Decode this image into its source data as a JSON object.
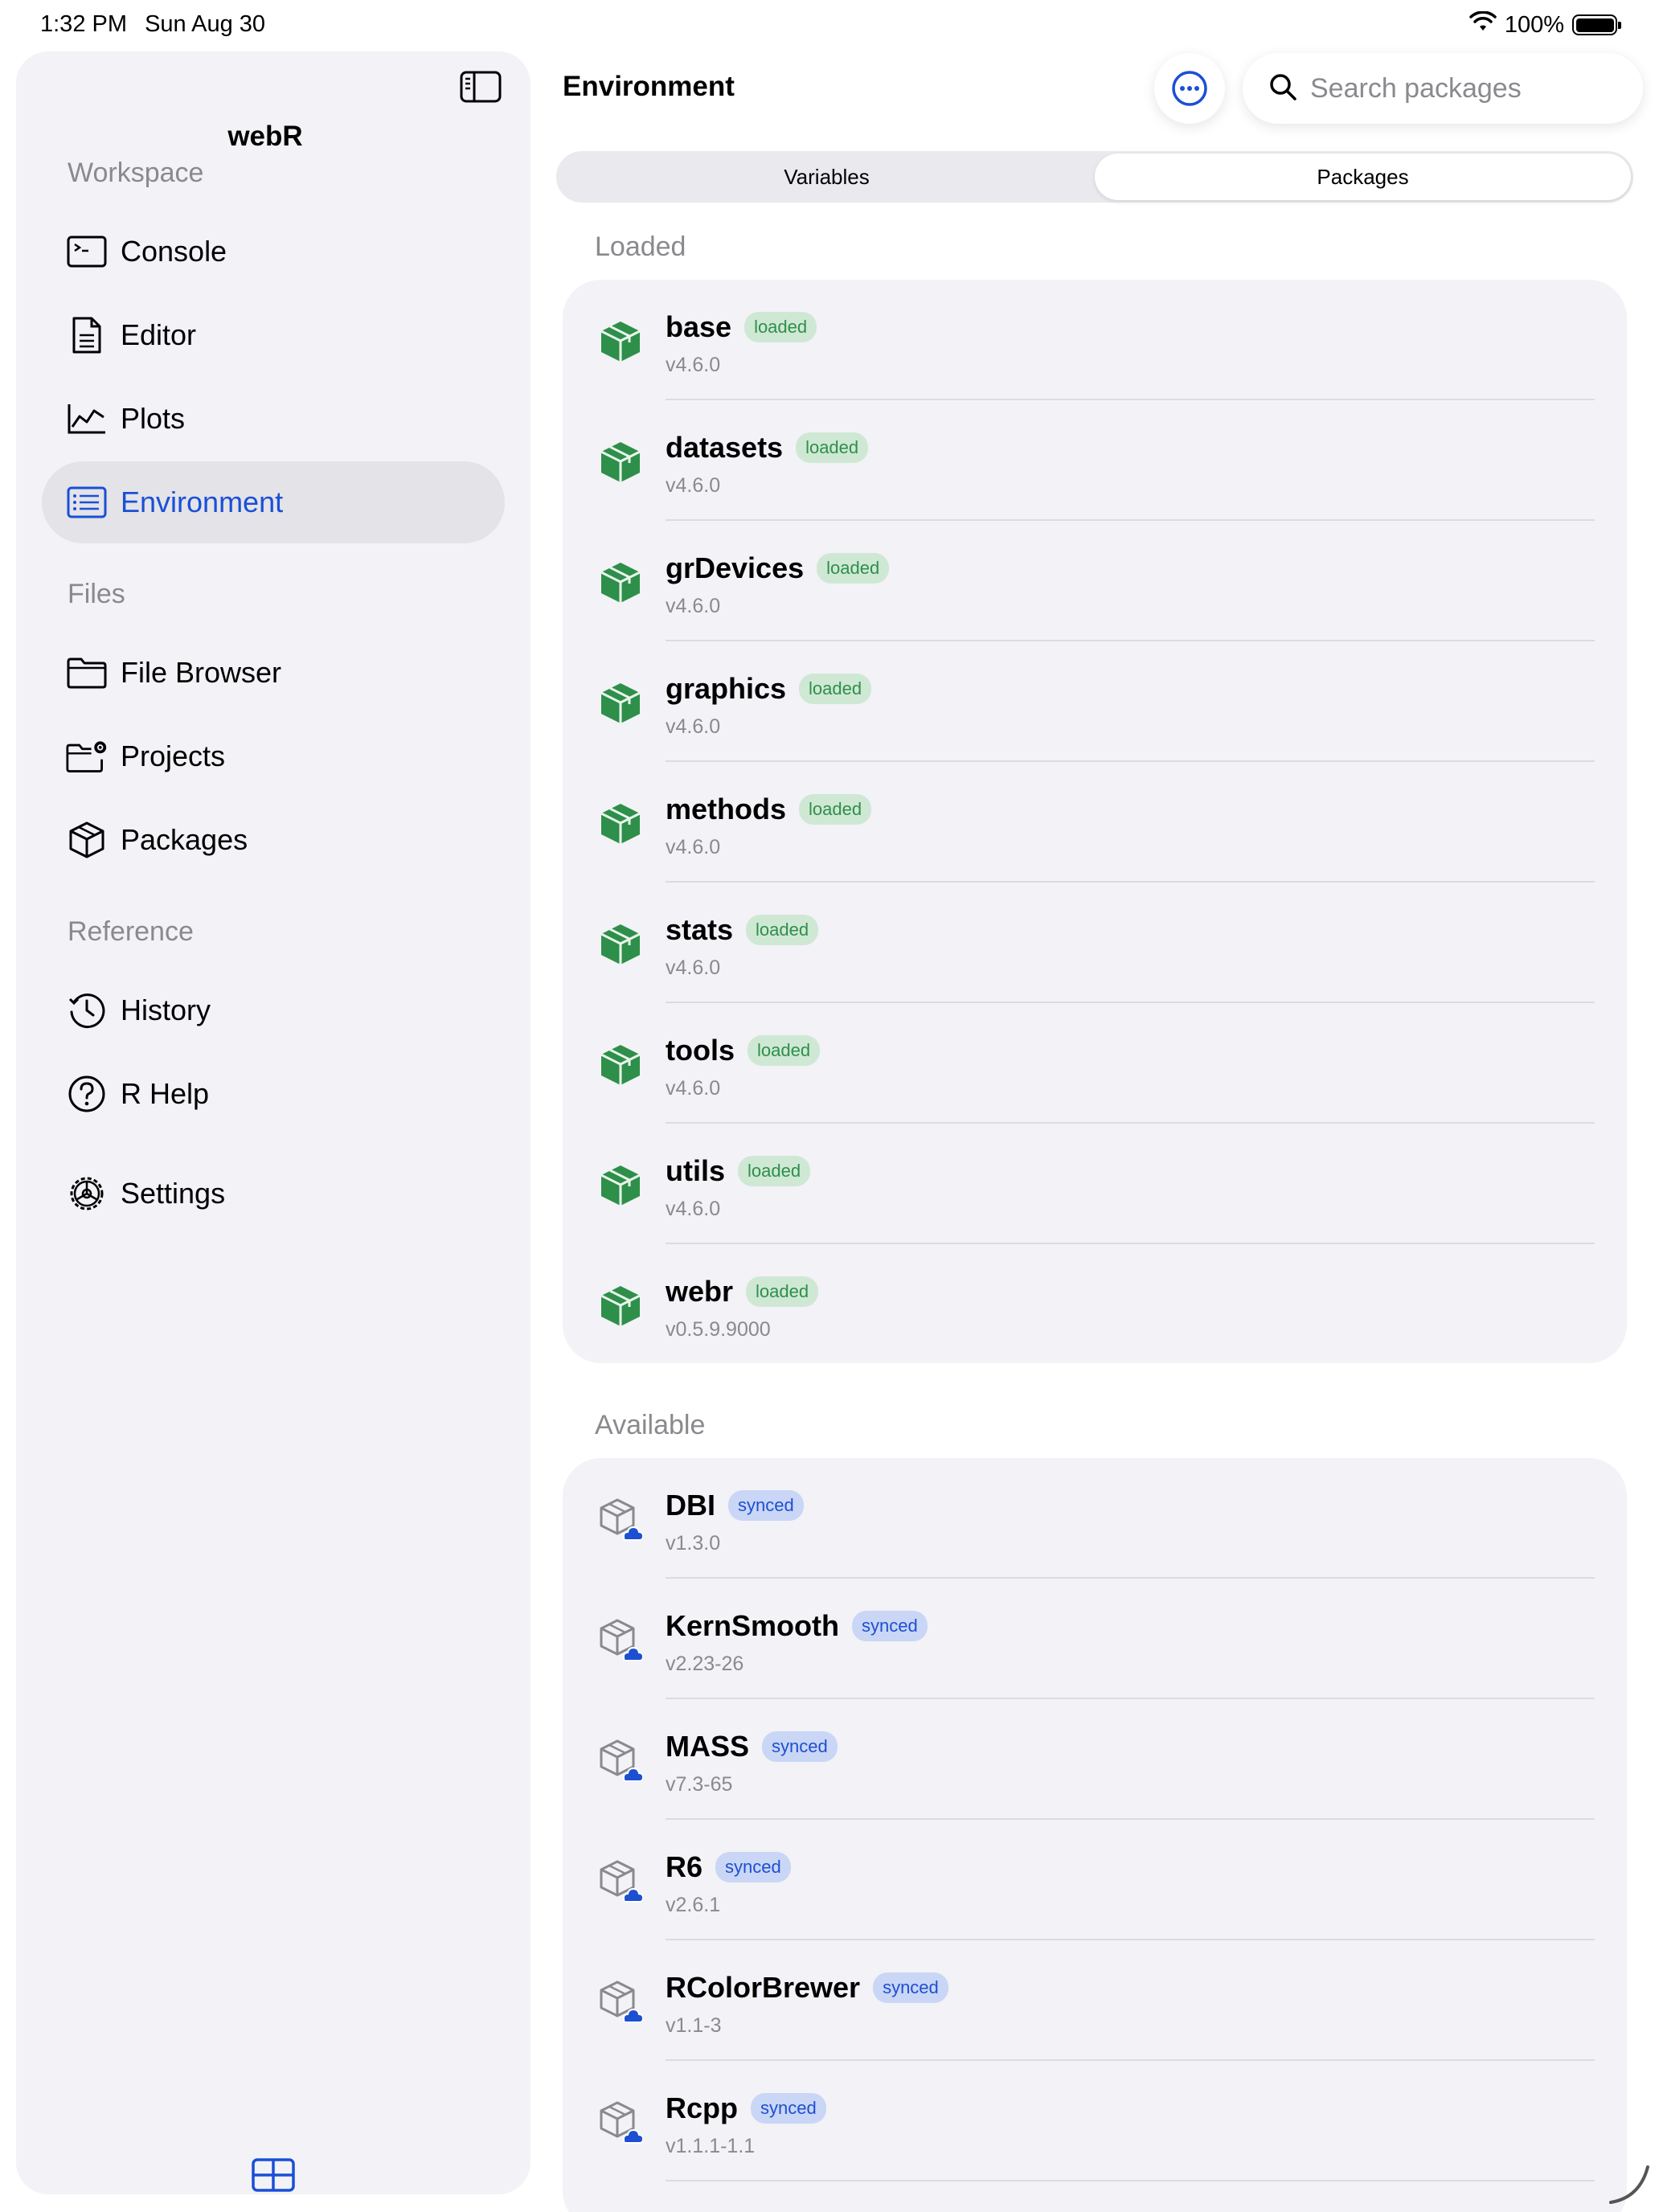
{
  "status_bar": {
    "time": "1:32 PM",
    "date": "Sun Aug 30",
    "battery": "100%"
  },
  "sidebar": {
    "title": "webR",
    "sections": {
      "workspace": "Workspace",
      "files": "Files",
      "reference": "Reference"
    },
    "items": [
      {
        "label": "Console",
        "icon": "terminal-icon"
      },
      {
        "label": "Editor",
        "icon": "document-icon"
      },
      {
        "label": "Plots",
        "icon": "chart-line-icon"
      },
      {
        "label": "Environment",
        "icon": "list-rectangle-icon"
      },
      {
        "label": "File Browser",
        "icon": "folder-icon"
      },
      {
        "label": "Projects",
        "icon": "folder-gear-icon"
      },
      {
        "label": "Packages",
        "icon": "cube-icon"
      },
      {
        "label": "History",
        "icon": "clock-history-icon"
      },
      {
        "label": "R Help",
        "icon": "question-circle-icon"
      },
      {
        "label": "Settings",
        "icon": "gear-icon"
      }
    ],
    "active_item": "Environment"
  },
  "main": {
    "title": "Environment",
    "search": {
      "placeholder": "Search packages",
      "value": ""
    },
    "tabs": [
      {
        "label": "Variables",
        "active": false
      },
      {
        "label": "Packages",
        "active": true
      }
    ],
    "loaded_label": "Loaded",
    "available_label": "Available",
    "loaded_packages": [
      {
        "name": "base",
        "badge": "loaded",
        "version": "v4.6.0"
      },
      {
        "name": "datasets",
        "badge": "loaded",
        "version": "v4.6.0"
      },
      {
        "name": "grDevices",
        "badge": "loaded",
        "version": "v4.6.0"
      },
      {
        "name": "graphics",
        "badge": "loaded",
        "version": "v4.6.0"
      },
      {
        "name": "methods",
        "badge": "loaded",
        "version": "v4.6.0"
      },
      {
        "name": "stats",
        "badge": "loaded",
        "version": "v4.6.0"
      },
      {
        "name": "tools",
        "badge": "loaded",
        "version": "v4.6.0"
      },
      {
        "name": "utils",
        "badge": "loaded",
        "version": "v4.6.0"
      },
      {
        "name": "webr",
        "badge": "loaded",
        "version": "v0.5.9.9000"
      }
    ],
    "available_packages": [
      {
        "name": "DBI",
        "badge": "synced",
        "version": "v1.3.0"
      },
      {
        "name": "KernSmooth",
        "badge": "synced",
        "version": "v2.23-26"
      },
      {
        "name": "MASS",
        "badge": "synced",
        "version": "v7.3-65"
      },
      {
        "name": "R6",
        "badge": "synced",
        "version": "v2.6.1"
      },
      {
        "name": "RColorBrewer",
        "badge": "synced",
        "version": "v1.1-3"
      },
      {
        "name": "Rcpp",
        "badge": "synced",
        "version": "v1.1.1-1.1"
      }
    ]
  },
  "colors": {
    "accent": "#1a4fd6",
    "loaded_green": "#2e8f4a",
    "synced_blue": "#1d4fd1",
    "secondary_text": "#8a8a8e"
  }
}
